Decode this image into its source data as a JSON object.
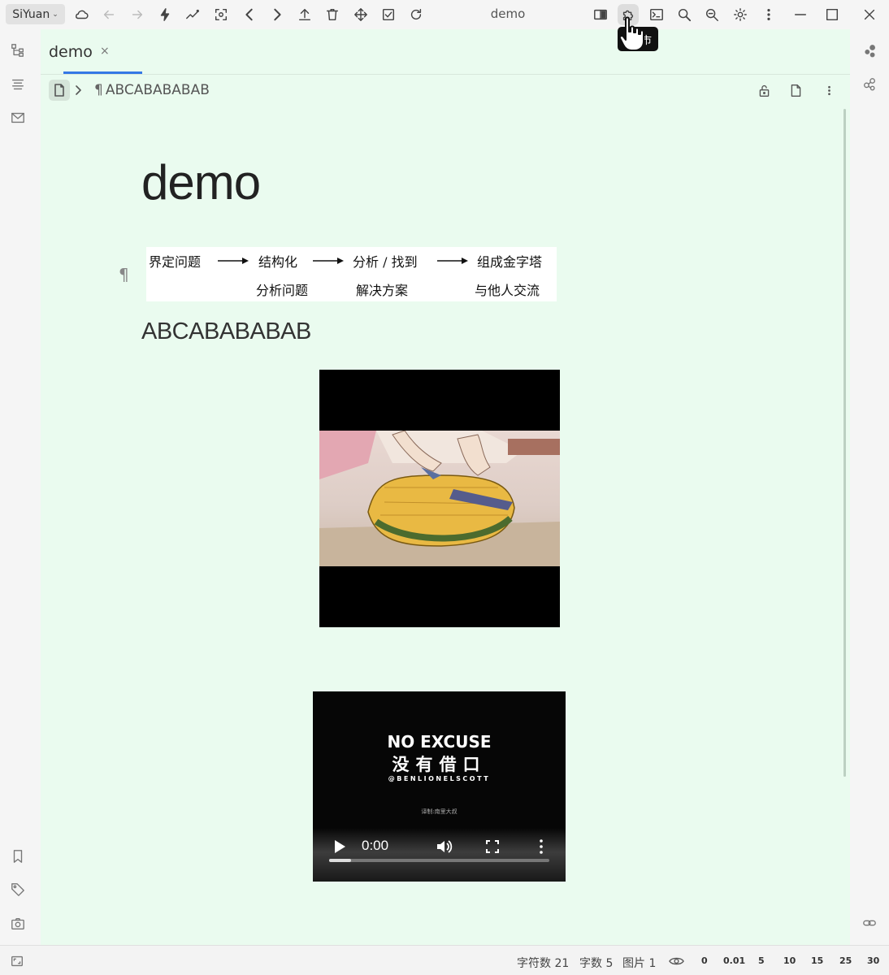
{
  "app": {
    "brand": "SiYuan",
    "window_title": "demo",
    "tooltip": "集市"
  },
  "tab": {
    "label": "demo",
    "close": "×"
  },
  "breadcrumb": {
    "current": "ABCABABABAB"
  },
  "document": {
    "title": "demo",
    "flowchart": {
      "steps": [
        "界定问题",
        "结构化",
        "分析 / 找到",
        "组成金字塔"
      ],
      "substeps": [
        "分析问题",
        "解决方案",
        "与他人交流"
      ]
    },
    "paragraph": "ABCABABABAB",
    "video": {
      "title": "NO EXCUSE",
      "subtitle_cn": "没有借口",
      "handle": "@BENLIONELSCOTT",
      "credit": "译制:南里大叔",
      "time": "0:00",
      "progress": 0.1
    }
  },
  "status": {
    "chars": "字符数 21",
    "words": "字数 5",
    "images": "图片 1",
    "zoom_levels": [
      "0",
      "0.01",
      "5",
      "10",
      "15",
      "25",
      "30"
    ]
  },
  "colors": {
    "accent": "#3578e5",
    "editor_bg": "#eafbef"
  }
}
